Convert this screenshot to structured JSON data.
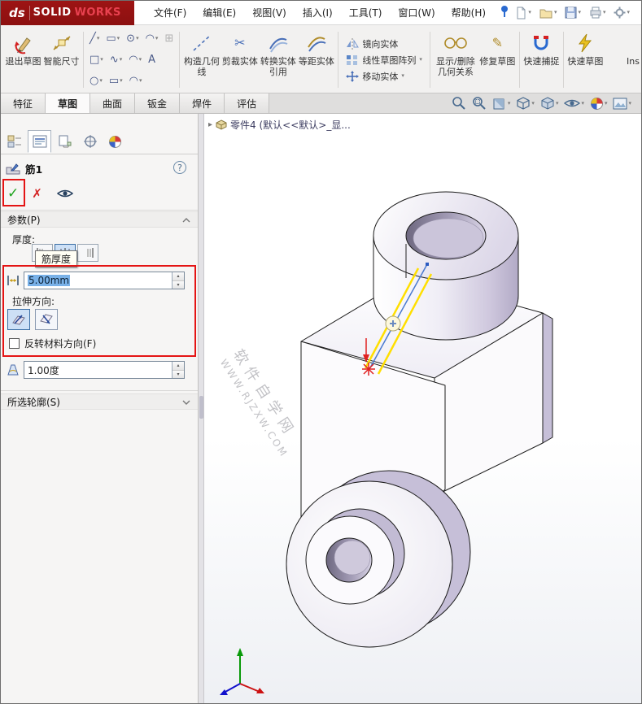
{
  "colors": {
    "logo_bg": "#8c1010",
    "logo_accent": "#e8414f",
    "highlight_box": "#e41414",
    "selection_blue": "#79b1e8",
    "model_lavender": "#c6bfd8",
    "sketch_yellow": "#ffdf00",
    "sketch_blue": "#4a7ad0",
    "ok_green": "#1fa41f",
    "cancel_red": "#d42424"
  },
  "menubar": {
    "logo_ds": "ds",
    "logo_solid": "SOLID",
    "logo_works": "WORKS",
    "menus": [
      {
        "label": "文件(F)"
      },
      {
        "label": "编辑(E)"
      },
      {
        "label": "视图(V)"
      },
      {
        "label": "插入(I)"
      },
      {
        "label": "工具(T)"
      },
      {
        "label": "窗口(W)"
      },
      {
        "label": "帮助(H)"
      }
    ]
  },
  "toolbar": {
    "exit_sketch": "退出草图",
    "smart_dim": "智能尺寸",
    "construction_geo": "构造几何线",
    "trim": "剪裁实体",
    "convert": "转换实体引用",
    "offset": "等距实体",
    "mirror": "镜向实体",
    "linear_pattern": "线性草图阵列",
    "move": "移动实体",
    "display_relations": "显示/删除几何关系",
    "repair": "修复草图",
    "quick_snap": "快速捕捉",
    "quick_sketch": "快速草图",
    "partial_right": "Ins"
  },
  "icons": {
    "caret": "▾",
    "breadcrumb_arrow": "▸",
    "check": "✓",
    "cross": "✗",
    "help": "?",
    "line": "╱",
    "rect": "▭",
    "square": "□",
    "circle": "○",
    "ellipse": "⊙",
    "arc": "◠",
    "spline": "∿",
    "text": "A",
    "picture": "⊞",
    "pencil": "✎",
    "scissors": "✂"
  },
  "tabs": [
    {
      "label": "特征"
    },
    {
      "label": "草图"
    },
    {
      "label": "曲面"
    },
    {
      "label": "钣金"
    },
    {
      "label": "焊件"
    },
    {
      "label": "评估"
    }
  ],
  "panel": {
    "title": "筋1",
    "sections": {
      "params": "参数(P)",
      "contours": "所选轮廓(S)"
    },
    "thickness_label": "厚度:",
    "tooltip": "筋厚度",
    "thickness_value": "5.00mm",
    "direction_label": "拉伸方向:",
    "flip_label": "反转材料方向(F)",
    "angle_value": "1.00度"
  },
  "viewport": {
    "breadcrumb": "零件4 (默认<<默认>_显...",
    "watermark_cn": "软件自学网",
    "watermark_en": "WWW.RJZXW.COM"
  }
}
